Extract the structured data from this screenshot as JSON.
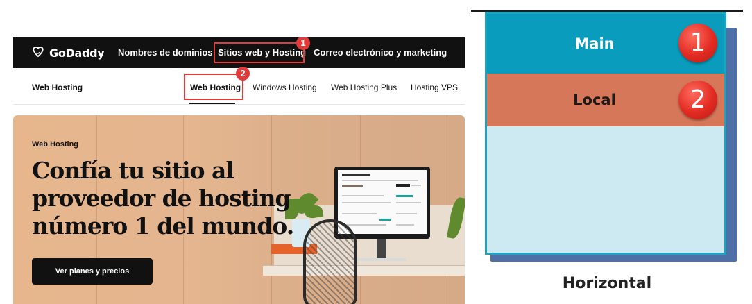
{
  "site": {
    "brand": "GoDaddy",
    "nav": {
      "domains": "Nombres de dominios",
      "hosting": "Sitios web y Hosting",
      "email": "Correo electrónico y marketing"
    },
    "subnav": {
      "title": "Web Hosting",
      "items": [
        "Web Hosting",
        "Windows Hosting",
        "Web Hosting Plus",
        "Hosting VPS"
      ]
    },
    "hero": {
      "label": "Web Hosting",
      "title": "Confía tu sitio al proveedor de hosting número 1 del mundo.",
      "cta": "Ver planes y precios"
    },
    "callouts": [
      "1",
      "2"
    ],
    "colors": {
      "nav_bg": "#111111",
      "highlight": "#e23a3a"
    }
  },
  "diagram": {
    "bands": [
      {
        "label": "Main",
        "number": "1",
        "color": "#0a9cbc"
      },
      {
        "label": "Local",
        "number": "2",
        "color": "#d6775a"
      }
    ],
    "content_color": "#cde9f2",
    "caption": "Horizontal"
  }
}
